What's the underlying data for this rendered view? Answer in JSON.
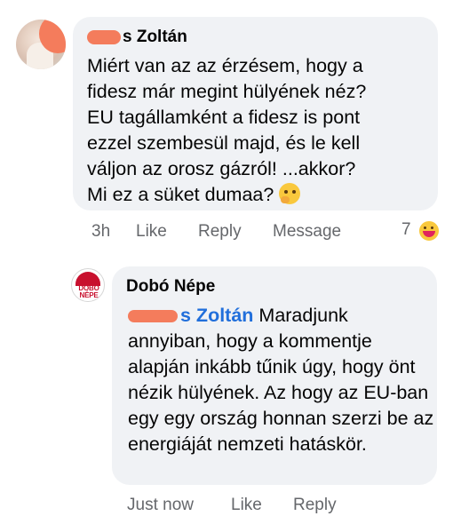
{
  "comment1": {
    "author_visible": "s Zoltán",
    "text": "Miért van az az érzésem, hogy a\nfidesz már megint hülyének néz?\nEU tagállamként a fidesz is pont\nezzel szembesül majd, és le kell\nváljon az orosz gázról! ...akkor?\nMi ez a süket dumaa?",
    "emoji": "thinking-face",
    "meta": {
      "time": "3h",
      "like": "Like",
      "reply": "Reply",
      "message": "Message"
    },
    "reaction_count": "7",
    "reaction_icon": "laughing-reaction-icon"
  },
  "comment2": {
    "author": "Dobó Népe",
    "avatar_text": "DOBÓ NÉPE",
    "mention_visible": "s Zoltán",
    "text": "Maradjunk annyiban, hogy a kommentje alapján inkább tűnik úgy, hogy önt nézik hülyének. Az hogy az EU-ban egy egy ország honnan szerzi be az energiáját nemzeti hatáskör.",
    "meta": {
      "time": "Just now",
      "like": "Like",
      "reply": "Reply"
    }
  },
  "colors": {
    "bubble": "#f0f2f5",
    "meta_text": "#65676b",
    "mention": "#216fdb",
    "redaction": "#f47c5c"
  }
}
